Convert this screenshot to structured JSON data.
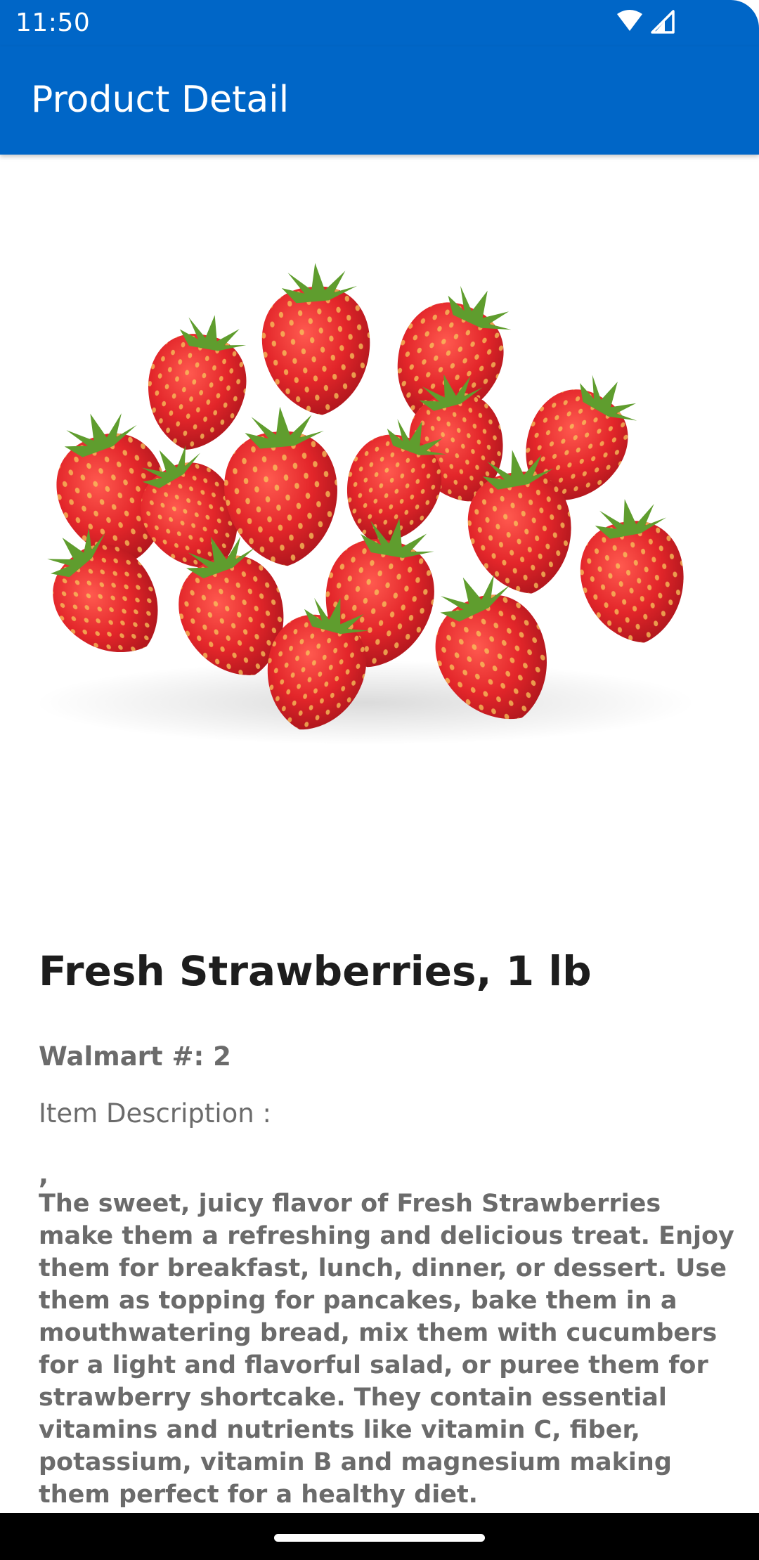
{
  "status_bar": {
    "time": "11:50",
    "icons": [
      "wifi-icon",
      "cellular-signal-icon"
    ]
  },
  "app_bar": {
    "title": "Product Detail",
    "color": "#0066c7"
  },
  "product": {
    "image_alt": "strawberries-image",
    "name": "Fresh Strawberries, 1 lb",
    "walmart_number": "Walmart #: 2",
    "description_label": "Item Description :",
    "description_prefix": ",",
    "description": "The sweet, juicy flavor of Fresh Strawberries make them a refreshing and delicious treat. Enjoy them for breakfast, lunch, dinner, or dessert. Use them as topping for pancakes, bake them in a mouthwatering bread, mix them with cucumbers for a light and flavorful salad, or puree them for strawberry shortcake. They contain essential vitamins and nutrients like vitamin C, fiber, potassium, vitamin B and magnesium making them perfect for a healthy diet."
  }
}
